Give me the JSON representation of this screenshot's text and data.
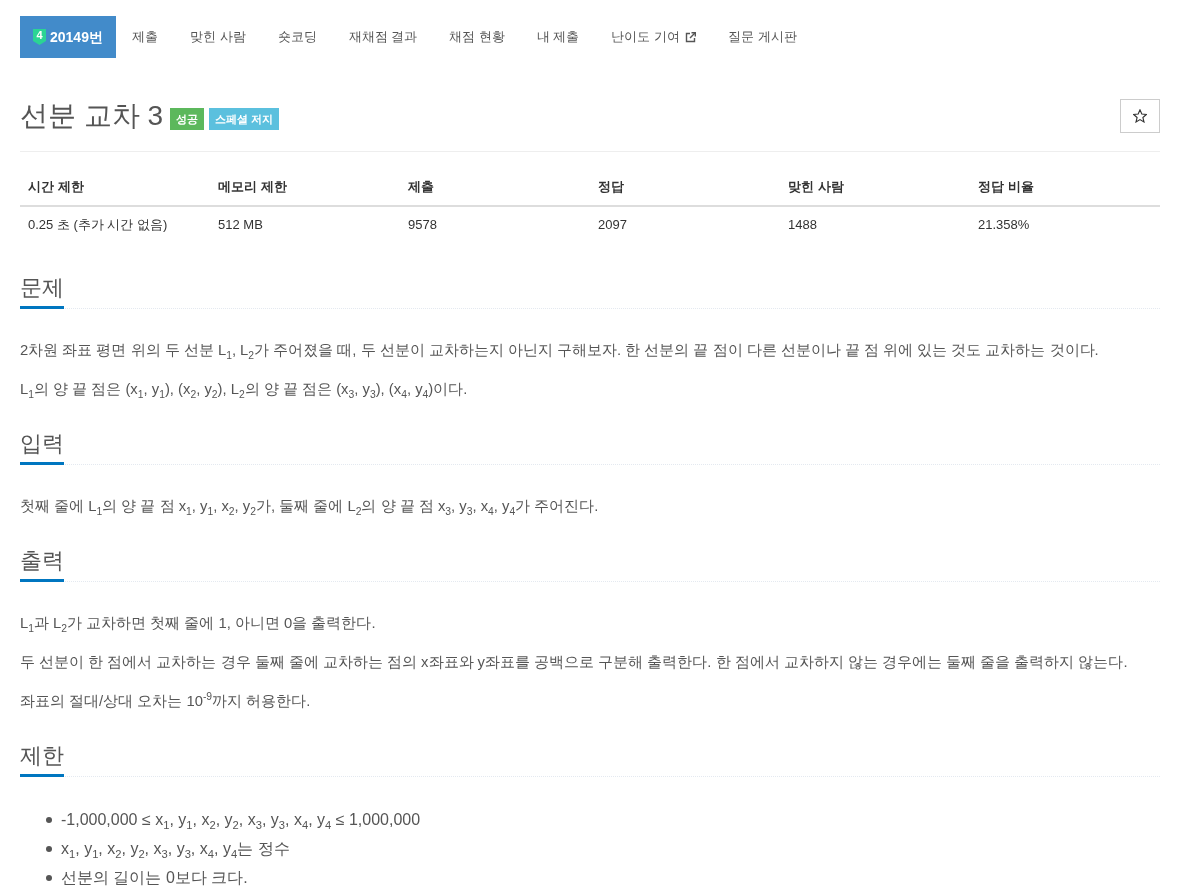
{
  "nav": {
    "tabs": [
      {
        "label": "20149번",
        "tier": "4",
        "selected": true,
        "external": false
      },
      {
        "label": "제출",
        "selected": false,
        "external": false
      },
      {
        "label": "맞힌 사람",
        "selected": false,
        "external": false
      },
      {
        "label": "숏코딩",
        "selected": false,
        "external": false
      },
      {
        "label": "재채점 결과",
        "selected": false,
        "external": false
      },
      {
        "label": "채점 현황",
        "selected": false,
        "external": false
      },
      {
        "label": "내 제출",
        "selected": false,
        "external": false
      },
      {
        "label": "난이도 기여",
        "selected": false,
        "external": true
      },
      {
        "label": "질문 게시판",
        "selected": false,
        "external": false
      }
    ]
  },
  "problem": {
    "title": "선분 교차 3",
    "labels": [
      {
        "text": "성공",
        "kind": "success"
      },
      {
        "text": "스페셜 저지",
        "kind": "info"
      }
    ],
    "starred": false
  },
  "info_table": {
    "columns": [
      "시간 제한",
      "메모리 제한",
      "제출",
      "정답",
      "맞힌 사람",
      "정답 비율"
    ],
    "rows": [
      [
        "0.25 초 (추가 시간 없음)",
        "512 MB",
        "9578",
        "2097",
        "1488",
        "21.358%"
      ]
    ]
  },
  "sections": [
    {
      "heading": "문제",
      "kind": "text",
      "lines": [
        "2차원 좌표 평면 위의 두 선분 L$_{1}$, L$_{2}$가 주어졌을 때, 두 선분이 교차하는지 아닌지 구해보자. 한 선분의 끝 점이 다른 선분이나 끝 점 위에 있는 것도 교차하는 것이다.",
        "L$_{1}$의 양 끝 점은 (x$_{1}$, y$_{1}$), (x$_{2}$, y$_{2}$), L$_{2}$의 양 끝 점은 (x$_{3}$, y$_{3}$), (x$_{4}$, y$_{4}$)이다."
      ]
    },
    {
      "heading": "입력",
      "kind": "text",
      "lines": [
        "첫째 줄에 L$_{1}$의 양 끝 점 x$_{1}$, y$_{1}$, x$_{2}$, y$_{2}$가, 둘째 줄에 L$_{2}$의 양 끝 점 x$_{3}$, y$_{3}$, x$_{4}$, y$_{4}$가 주어진다."
      ]
    },
    {
      "heading": "출력",
      "kind": "text",
      "lines": [
        "L$_{1}$과 L$_{2}$가 교차하면 첫째 줄에 1, 아니면 0을 출력한다.",
        "두 선분이 한 점에서 교차하는 경우 둘째 줄에 교차하는 점의 x좌표와 y좌표를 공백으로 구분해 출력한다. 한 점에서 교차하지 않는 경우에는 둘째 줄을 출력하지 않는다.",
        "좌표의 절대/상대 오차는 10$^{-9}$까지 허용한다."
      ]
    },
    {
      "heading": "제한",
      "kind": "list",
      "lines": [
        "-1,000,000 ≤ x$_{1}$, y$_{1}$, x$_{2}$, y$_{2}$, x$_{3}$, y$_{3}$, x$_{4}$, y$_{4}$ ≤ 1,000,000",
        "x$_{1}$, y$_{1}$, x$_{2}$, y$_{2}$, x$_{3}$, y$_{3}$, x$_{4}$, y$_{4}$는 정수",
        "선분의 길이는 0보다 크다."
      ]
    }
  ]
}
